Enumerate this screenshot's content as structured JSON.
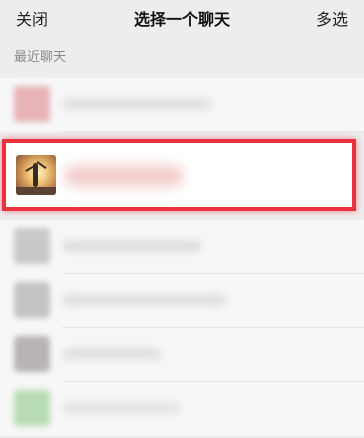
{
  "header": {
    "close_label": "关闭",
    "title": "选择一个聊天",
    "multi_select_label": "多选"
  },
  "section": {
    "recent_label": "最近聊天"
  },
  "colors": {
    "highlight": "#e8323f",
    "background": "#ededed"
  },
  "icons": {
    "selected_chat_avatar": "ballet-dancer-avatar"
  }
}
